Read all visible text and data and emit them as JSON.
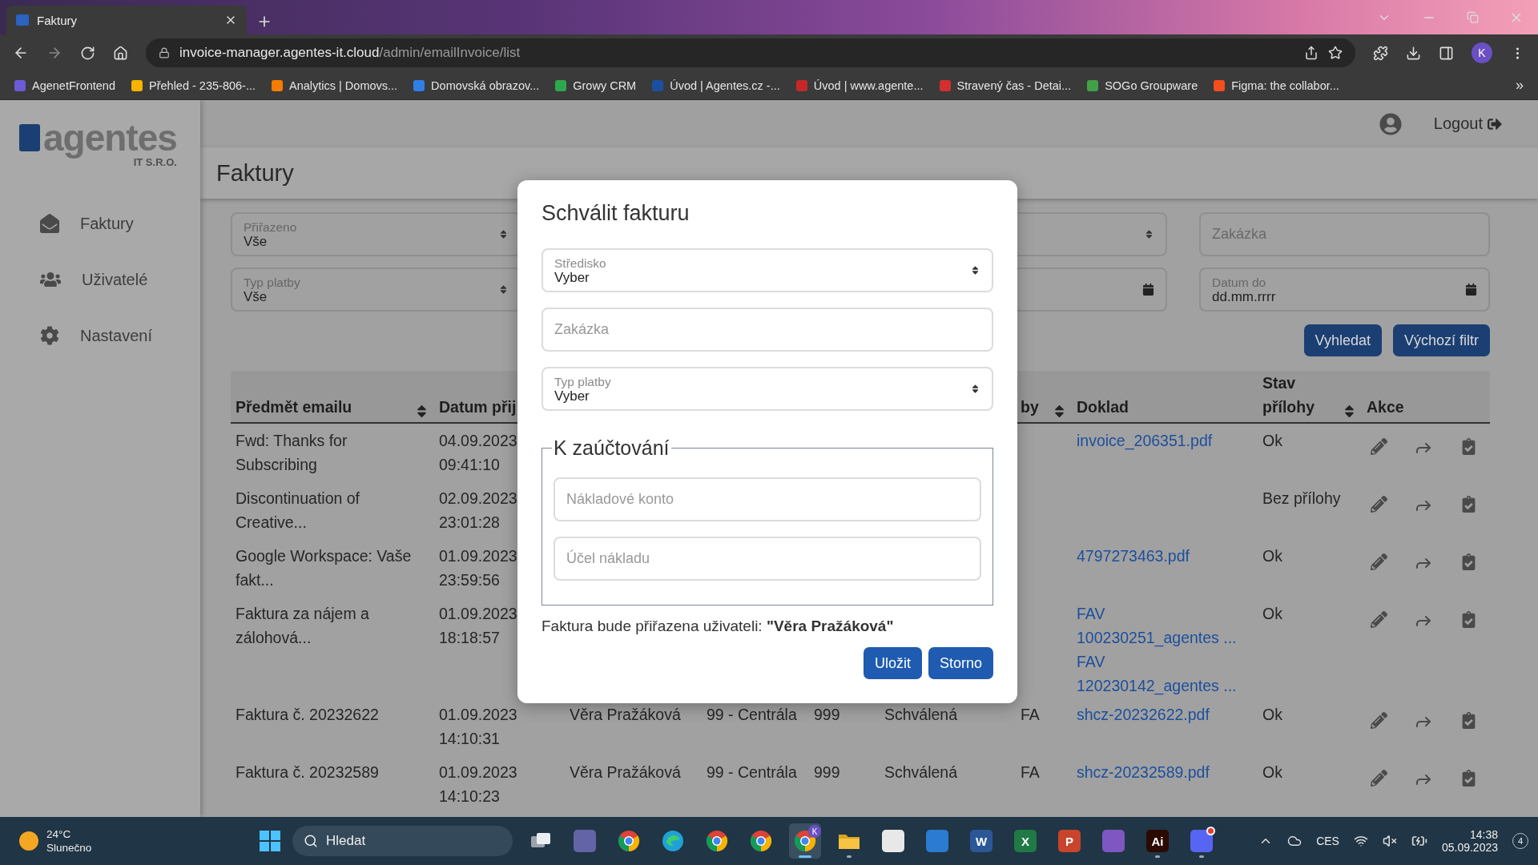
{
  "browser": {
    "tab": {
      "title": "Faktury",
      "selected": true
    },
    "url": {
      "host": "invoice-manager.agentes-it.cloud",
      "path": "/admin/emailInvoice/list"
    },
    "profile": "K",
    "bookmarks": [
      {
        "label": "AgenetFrontend",
        "color": "#6b5bd6"
      },
      {
        "label": "Přehled - 235-806-...",
        "color": "#f4b400"
      },
      {
        "label": "Analytics | Domovs...",
        "color": "#f57c00"
      },
      {
        "label": "Domovská obrazov...",
        "color": "#2f7fe6"
      },
      {
        "label": "Growy CRM",
        "color": "#2ea84f"
      },
      {
        "label": "Úvod | Agentes.cz -...",
        "color": "#1d4fa0"
      },
      {
        "label": "Úvod | www.agente...",
        "color": "#c62828"
      },
      {
        "label": "Stravený čas - Detai...",
        "color": "#d32f2f"
      },
      {
        "label": "SOGo Groupware",
        "color": "#43a047"
      },
      {
        "label": "Figma: the collabor...",
        "color": "#f24e1e"
      }
    ],
    "more": "»"
  },
  "app": {
    "logo": {
      "text": "agentes",
      "sub": "IT S.R.O."
    },
    "nav": [
      {
        "label": "Faktury"
      },
      {
        "label": "Uživatelé"
      },
      {
        "label": "Nastavení"
      }
    ],
    "logout": "Logout",
    "page_title": "Faktury",
    "filters": [
      [
        {
          "kind": "select",
          "label": "Přiřazeno",
          "value": "Vše"
        },
        {
          "kind": "select"
        },
        {
          "kind": "text",
          "placeholder": "Zakázka"
        }
      ],
      [
        {
          "kind": "select",
          "label": "Typ platby",
          "value": "Vše"
        },
        {
          "kind": "date"
        },
        {
          "kind": "date",
          "label": "Datum do",
          "value": "dd.mm.rrrr"
        }
      ]
    ],
    "filter_buttons": [
      "Vyhledat",
      "Výchozí filtr"
    ],
    "table": {
      "columns": [
        {
          "label": "Předmět emailu",
          "sortable": true
        },
        {
          "label": "Datum přij"
        },
        {
          "label": "by",
          "sortable": true
        },
        {
          "label": "Doklad"
        },
        {
          "label": "Stav přílohy",
          "sortable": true
        },
        {
          "label": "Akce"
        }
      ],
      "rows": [
        {
          "subject": "Fwd: Thanks for Subscribing",
          "received": "04.09.2023 09:41:10",
          "documents": [
            "invoice_206351.pdf"
          ],
          "attachment": "Ok"
        },
        {
          "subject": "Discontinuation of Creative...",
          "received": "02.09.2023 23:01:28",
          "attachment": "Bez přílohy"
        },
        {
          "subject": "Google Workspace: Vaše fakt...",
          "received": "01.09.2023 23:59:56",
          "documents": [
            "4797273463.pdf"
          ],
          "attachment": "Ok"
        },
        {
          "subject": "Faktura za nájem a zálohová...",
          "received": "01.09.2023 18:18:57",
          "documents": [
            "FAV 100230251_agentes ...",
            "FAV 120230142_agentes ..."
          ],
          "attachment": "Ok"
        },
        {
          "subject": "Faktura č. 20232622",
          "received": "01.09.2023 14:10:31",
          "assignee": "Věra Pražáková",
          "center": "99 - Centrála",
          "number": "999",
          "state": "Schválená",
          "type": "FA",
          "documents": [
            "shcz-20232622.pdf"
          ],
          "attachment": "Ok"
        },
        {
          "subject": "Faktura č. 20232589",
          "received": "01.09.2023 14:10:23",
          "assignee": "Věra Pražáková",
          "center": "99 - Centrála",
          "number": "999",
          "state": "Schválená",
          "type": "FA",
          "documents": [
            "shcz-20232589.pdf"
          ],
          "attachment": "Ok"
        }
      ]
    }
  },
  "modal": {
    "title": "Schválit fakturu",
    "fields": [
      {
        "kind": "select",
        "label": "Středisko",
        "value": "Vyber"
      },
      {
        "kind": "text",
        "placeholder": "Zakázka"
      },
      {
        "kind": "select",
        "label": "Typ platby",
        "value": "Vyber"
      }
    ],
    "fieldset": {
      "legend": "K zaúčtování",
      "fields": [
        {
          "kind": "text",
          "placeholder": "Nákladové konto"
        },
        {
          "kind": "text",
          "placeholder": "Účel nákladu"
        }
      ]
    },
    "note": "Faktura bude přiřazena uživateli: **\"Věra Pražáková\"**",
    "buttons": [
      "Uložit",
      "Storno"
    ]
  },
  "taskbar": {
    "weather": {
      "temp": "24°C",
      "desc": "Slunečno"
    },
    "search": "Hledat",
    "apps": [
      {
        "kind": "taskview",
        "color": "#9aa3ab",
        "running": false,
        "selected": false
      },
      {
        "kind": "tile",
        "color": "#6264a7",
        "running": false,
        "selected": false
      },
      {
        "kind": "chrome",
        "running": false,
        "selected": false
      },
      {
        "kind": "edge",
        "color": "#1fa1d8",
        "running": false,
        "selected": false
      },
      {
        "kind": "chrome",
        "running": false,
        "selected": false
      },
      {
        "kind": "chrome",
        "running": false,
        "selected": false
      },
      {
        "kind": "chrome",
        "badge": "K",
        "running": true,
        "selected": true
      },
      {
        "kind": "folder",
        "color": "#f6c343",
        "running": true,
        "selected": false
      },
      {
        "kind": "tile",
        "color": "#e8e8e8",
        "running": false,
        "selected": false
      },
      {
        "kind": "tile",
        "color": "#2a7bd1",
        "running": false,
        "selected": false
      },
      {
        "kind": "tile",
        "color": "#2b5797",
        "glyph": "W",
        "running": false,
        "selected": false
      },
      {
        "kind": "tile",
        "color": "#1f7a45",
        "glyph": "X",
        "running": false,
        "selected": false
      },
      {
        "kind": "tile",
        "color": "#c8442a",
        "glyph": "P",
        "running": false,
        "selected": false
      },
      {
        "kind": "tile",
        "color": "#7e57c2",
        "running": false,
        "selected": false
      },
      {
        "kind": "tile",
        "color": "#2b0a00",
        "glyph": "Ai",
        "running": true,
        "selected": false
      },
      {
        "kind": "tile",
        "color": "#5865f2",
        "dot": true,
        "running": true,
        "selected": false
      }
    ],
    "lang": "CES",
    "time": "14:38",
    "date": "05.09.2023",
    "notifications": "4"
  }
}
